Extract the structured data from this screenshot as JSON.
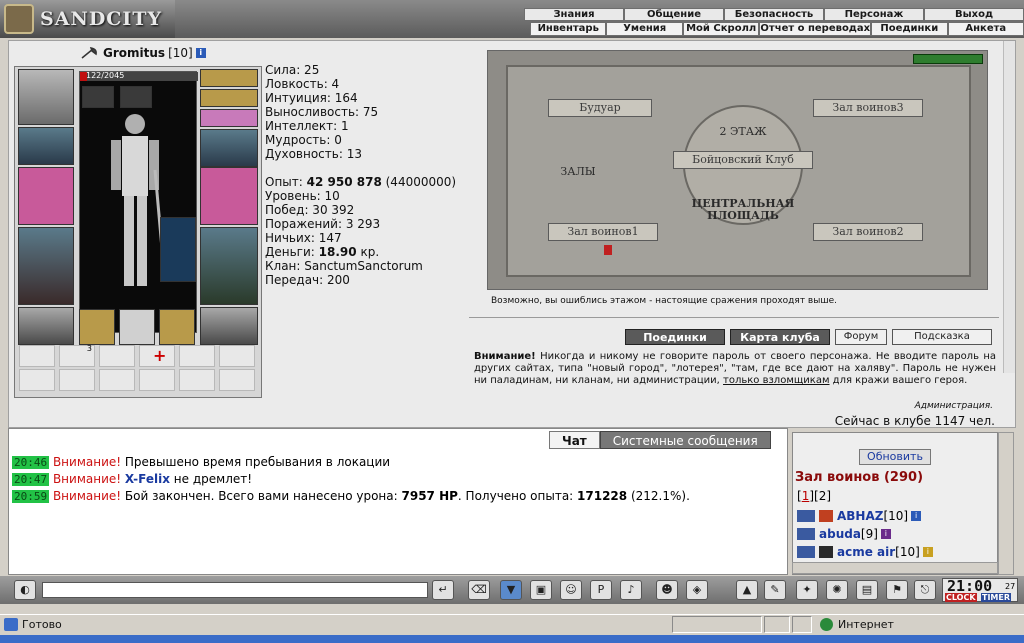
{
  "app": {
    "logo": "SANDCITY"
  },
  "menu": {
    "row1": [
      "Знания",
      "Общение",
      "Безопасность",
      "Персонаж",
      "Выход"
    ],
    "row2": [
      "Инвентарь",
      "Умения",
      "Мой Скролл",
      "Отчет о переводах",
      "Поединки",
      "Анкета"
    ]
  },
  "character": {
    "name": "Gromitus",
    "level": "[10]",
    "hp": "122/2045",
    "hp_fraction": 0.06,
    "counter": "3"
  },
  "stats": {
    "strength": "Сила: 25",
    "agility": "Ловкость: 4",
    "intuition": "Интуиция: 164",
    "stamina": "Выносливость: 75",
    "intellect": "Интеллект: 1",
    "wisdom": "Мудрость: 0",
    "spirit": "Духовность: 13",
    "exp_label": "Опыт:",
    "exp_value": "42 950 878",
    "exp_next": "(44000000)",
    "level": "Уровень: 10",
    "wins": "Побед: 30 392",
    "losses": "Поражений: 3 293",
    "draws": "Ничьих: 147",
    "money_label": "Деньги:",
    "money_value": "18.90",
    "money_unit": "кр.",
    "clan": "Клан: SanctumSanctorum",
    "transfers": "Передач: 200"
  },
  "map": {
    "boudoir": "Будуар",
    "hall3": "Зал воинов3",
    "floor": "2 ЭТАЖ",
    "club": "Бойцовский Клуб",
    "halls": "ЗАЛЫ",
    "central_line1": "ЦЕНТРАЛЬНАЯ",
    "central_line2": "ПЛОЩАДЬ",
    "hall1": "Зал воинов1",
    "hall2": "Зал воинов2",
    "message": "Возможно, вы ошиблись этажом - настоящие сражения проходят выше."
  },
  "buttons": {
    "duels": "Поединки",
    "club_map": "Карта клуба",
    "forum": "Форум",
    "hint": "Подсказка",
    "refresh": "Обновить"
  },
  "warning": {
    "title": "Внимание!",
    "text1": " Никогда и никому не говорите пароль от своего персонажа. Не вводите пароль на других сайтах, типа \"новый город\", \"лотерея\", \"там, где все дают на халяву\". Пароль не нужен ни паладинам, ни кланам, ни администрации, ",
    "link": "только взломщикам",
    "text2": " для кражи вашего героя.",
    "signature": "Администрация.",
    "online": "Сейчас в клубе 1147 чел."
  },
  "chat": {
    "tab_chat": "Чат",
    "tab_system": "Системные сообщения",
    "lines": [
      {
        "time": "20:46",
        "label": "Внимание!",
        "text": " Превышено время пребывания в локации"
      },
      {
        "time": "20:47",
        "label": "Внимание!",
        "nick": "X-Felix",
        "text": " не дремлет!"
      },
      {
        "time": "20:59",
        "label": "Внимание!",
        "text": " Бой закончен. Всего вами нанесено урона: ",
        "b1": "7957 HP",
        "text2": ". Получено опыта: ",
        "b2": "171228",
        "text3": " (212.1%)."
      }
    ]
  },
  "side": {
    "room_title": "Зал воинов (290)",
    "page1": "1",
    "page2": "2",
    "players": [
      {
        "name": "ABHAZ",
        "level": "[10]"
      },
      {
        "name": "abuda",
        "level": "[9]"
      },
      {
        "name": "acme air",
        "level": "[10]"
      }
    ]
  },
  "clock": {
    "time": "21:00",
    "seconds": "27",
    "label_clock": "CLOCK",
    "label_timer": "TIMER"
  },
  "status": {
    "text": "Готово",
    "zone": "Интернет"
  },
  "colors": {
    "accent": "#8a0a0a",
    "timestamp": "#22c246",
    "warning": "#cc1111",
    "link": "#1a3aa0"
  }
}
